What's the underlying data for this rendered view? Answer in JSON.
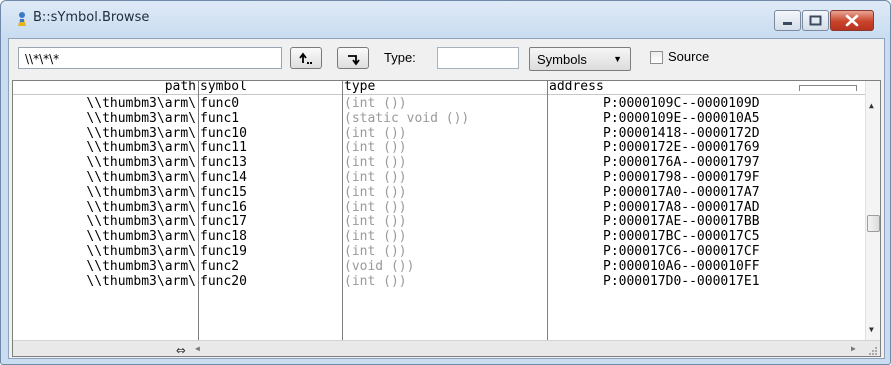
{
  "window": {
    "title": "B::sYmbol.Browse",
    "icon": "person-icon"
  },
  "window_controls": {
    "minimize": "minimize-icon",
    "maximize": "maximize-icon",
    "close": "close-icon"
  },
  "toolbar": {
    "filter_value": "\\\\*\\*\\*",
    "up_button_icon": "up-arrow-icon",
    "down_button_icon": "return-arrow-icon",
    "type_label": "Type:",
    "type_value": "",
    "symbols_select": "Symbols",
    "source_label": "Source",
    "source_checked": false
  },
  "table": {
    "headers": {
      "path": "path",
      "symbol": "symbol",
      "type": "type",
      "address": "address"
    },
    "rows": [
      {
        "path": "\\\\thumbm3\\arm\\",
        "symbol": "func0",
        "type": "(int ())",
        "address": "P:0000109C--0000109D"
      },
      {
        "path": "\\\\thumbm3\\arm\\",
        "symbol": "func1",
        "type": "(static void ())",
        "address": "P:0000109E--000010A5"
      },
      {
        "path": "\\\\thumbm3\\arm\\",
        "symbol": "func10",
        "type": "(int ())",
        "address": "P:00001418--0000172D"
      },
      {
        "path": "\\\\thumbm3\\arm\\",
        "symbol": "func11",
        "type": "(int ())",
        "address": "P:0000172E--00001769"
      },
      {
        "path": "\\\\thumbm3\\arm\\",
        "symbol": "func13",
        "type": "(int ())",
        "address": "P:0000176A--00001797"
      },
      {
        "path": "\\\\thumbm3\\arm\\",
        "symbol": "func14",
        "type": "(int ())",
        "address": "P:00001798--0000179F"
      },
      {
        "path": "\\\\thumbm3\\arm\\",
        "symbol": "func15",
        "type": "(int ())",
        "address": "P:000017A0--000017A7"
      },
      {
        "path": "\\\\thumbm3\\arm\\",
        "symbol": "func16",
        "type": "(int ())",
        "address": "P:000017A8--000017AD"
      },
      {
        "path": "\\\\thumbm3\\arm\\",
        "symbol": "func17",
        "type": "(int ())",
        "address": "P:000017AE--000017BB"
      },
      {
        "path": "\\\\thumbm3\\arm\\",
        "symbol": "func18",
        "type": "(int ())",
        "address": "P:000017BC--000017C5"
      },
      {
        "path": "\\\\thumbm3\\arm\\",
        "symbol": "func19",
        "type": "(int ())",
        "address": "P:000017C6--000017CF"
      },
      {
        "path": "\\\\thumbm3\\arm\\",
        "symbol": "func2",
        "type": "(void ())",
        "address": "P:000010A6--000010FF"
      },
      {
        "path": "\\\\thumbm3\\arm\\",
        "symbol": "func20",
        "type": "(int ())",
        "address": "P:000017D0--000017E1"
      }
    ]
  },
  "scrollbars": {
    "vertical_position": 0.55,
    "resize_icon": "column-resize-icon"
  },
  "colors": {
    "type_text": "#9a9a9a",
    "close_button": "#c9442a",
    "title_bar": "#c9dcf0"
  }
}
